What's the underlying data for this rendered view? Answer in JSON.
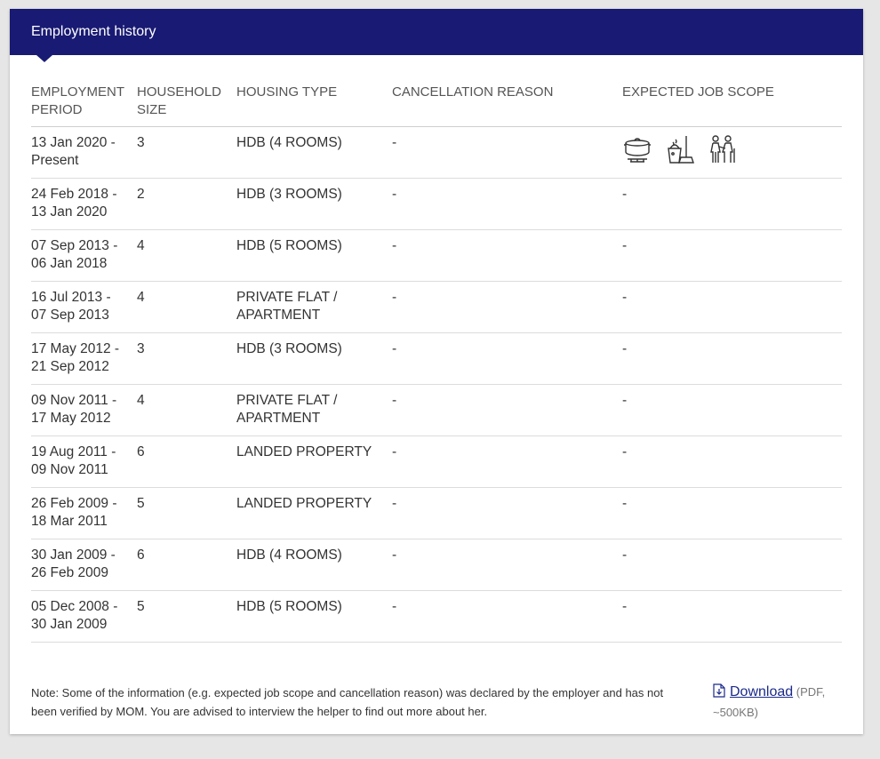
{
  "header": {
    "title": "Employment history"
  },
  "table": {
    "columns": [
      "EMPLOYMENT PERIOD",
      "HOUSEHOLD SIZE",
      "HOUSING TYPE",
      "CANCELLATION REASON",
      "EXPECTED JOB SCOPE"
    ],
    "rows": [
      {
        "period": "13 Jan 2020 - Present",
        "household": "3",
        "housing": "HDB (4 ROOMS)",
        "reason": "-",
        "scope": "",
        "scope_icons": [
          "cooking-pot-icon",
          "cleaning-bucket-broom-icon",
          "elderly-care-icon"
        ]
      },
      {
        "period": "24 Feb 2018 - 13 Jan 2020",
        "household": "2",
        "housing": "HDB (3 ROOMS)",
        "reason": "-",
        "scope": "-"
      },
      {
        "period": "07 Sep 2013 - 06 Jan 2018",
        "household": "4",
        "housing": "HDB (5 ROOMS)",
        "reason": "-",
        "scope": "-"
      },
      {
        "period": "16 Jul 2013 - 07 Sep 2013",
        "household": "4",
        "housing": "PRIVATE FLAT / APARTMENT",
        "reason": "-",
        "scope": "-"
      },
      {
        "period": "17 May 2012 - 21 Sep 2012",
        "household": "3",
        "housing": "HDB (3 ROOMS)",
        "reason": "-",
        "scope": "-"
      },
      {
        "period": "09 Nov 2011 - 17 May 2012",
        "household": "4",
        "housing": "PRIVATE FLAT / APARTMENT",
        "reason": "-",
        "scope": "-"
      },
      {
        "period": "19 Aug 2011 - 09 Nov 2011",
        "household": "6",
        "housing": "LANDED PROPERTY",
        "reason": "-",
        "scope": "-"
      },
      {
        "period": "26 Feb 2009 - 18 Mar 2011",
        "household": "5",
        "housing": "LANDED PROPERTY",
        "reason": "-",
        "scope": "-"
      },
      {
        "period": "30 Jan 2009 - 26 Feb 2009",
        "household": "6",
        "housing": "HDB (4 ROOMS)",
        "reason": "-",
        "scope": "-"
      },
      {
        "period": "05 Dec 2008 - 30 Jan 2009",
        "household": "5",
        "housing": "HDB (5 ROOMS)",
        "reason": "-",
        "scope": "-"
      }
    ]
  },
  "footer": {
    "note": "Note: Some of the information (e.g. expected job scope and cancellation reason) was declared by the employer and has not been verified by MOM. You are advised to interview the helper to find out more about her.",
    "download_label": "Download",
    "download_meta": "(PDF, ~500KB)",
    "download_icon": "file-download-icon"
  },
  "colors": {
    "header_bg": "#191a73",
    "link": "#1a2a8a",
    "page_bg": "#e6e6e6"
  }
}
